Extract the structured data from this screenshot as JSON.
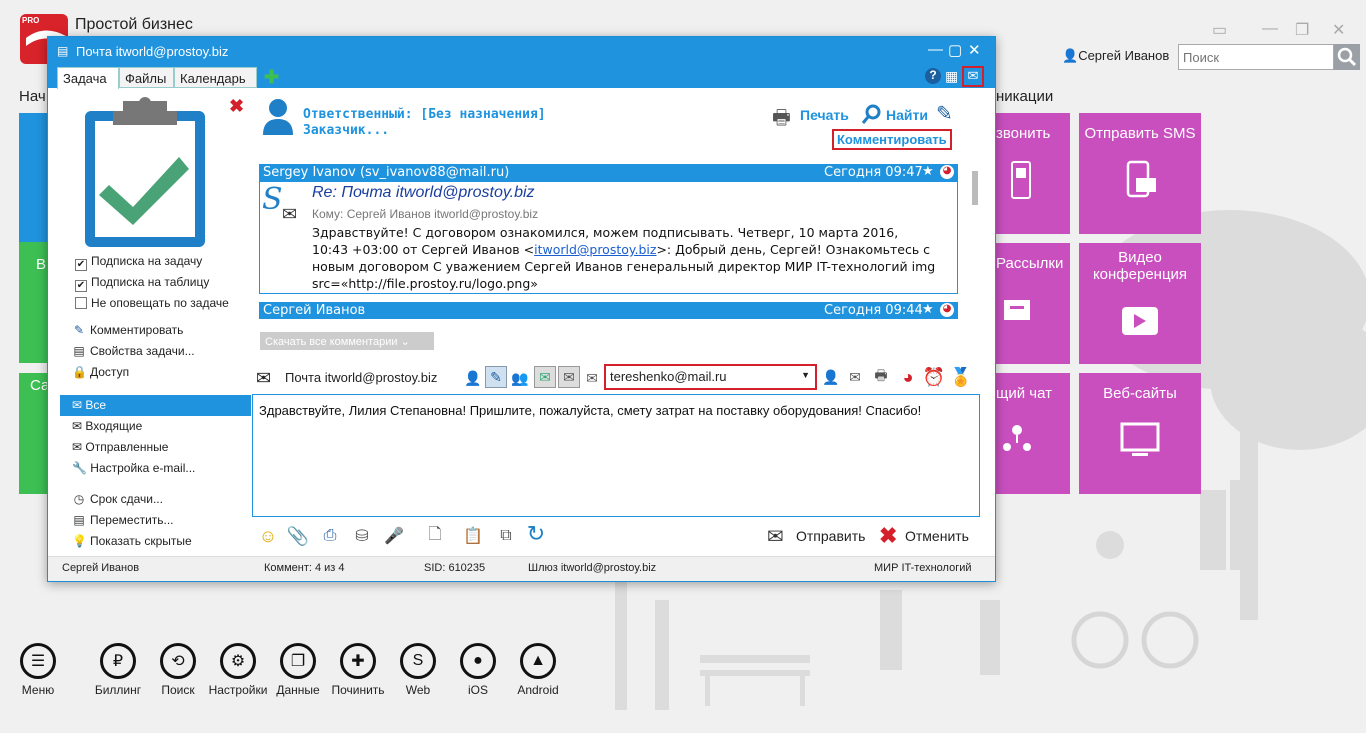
{
  "app": {
    "title": "Простой бизнес",
    "logo_text": "PRO",
    "user": "Сергей Иванов",
    "search_placeholder": "Поиск",
    "partial_left_label": "Нач",
    "partial_right_label": "никации"
  },
  "tiles": {
    "call": "звонить",
    "sms": "Отправить SMS",
    "mailing": "Рассылки",
    "video": "Видео конференция",
    "chat": "щий чат",
    "websites": "Веб-сайты",
    "left_partial_1": "В",
    "left_partial_2": "Са"
  },
  "dock": [
    {
      "label": "Меню",
      "icon": "menu-icon",
      "glyph": "☰"
    },
    {
      "label": "Биллинг",
      "icon": "billing-icon",
      "glyph": "₽"
    },
    {
      "label": "Поиск",
      "icon": "search-icon",
      "glyph": "⟲"
    },
    {
      "label": "Настройки",
      "icon": "gear-icon",
      "glyph": "⚙"
    },
    {
      "label": "Данные",
      "icon": "data-icon",
      "glyph": "❐"
    },
    {
      "label": "Починить",
      "icon": "repair-icon",
      "glyph": "✚"
    },
    {
      "label": "Web",
      "icon": "web-icon",
      "glyph": "S"
    },
    {
      "label": "iOS",
      "icon": "apple-icon",
      "glyph": "●"
    },
    {
      "label": "Android",
      "icon": "android-icon",
      "glyph": "▲"
    }
  ],
  "dialog": {
    "title": "Почта itworld@prostoy.biz",
    "tabs": [
      "Задача",
      "Файлы",
      "Календарь"
    ],
    "checkboxes": [
      {
        "label": "Подписка на задачу",
        "checked": true
      },
      {
        "label": "Подписка на таблицу",
        "checked": true
      },
      {
        "label": "Не оповещать по задаче",
        "checked": false
      }
    ],
    "actions": [
      "Комментировать",
      "Свойства задачи...",
      "Доступ"
    ],
    "folders": [
      "Все",
      "Входящие",
      "Отправленные",
      "Настройка e-mail..."
    ],
    "extras": [
      "Срок сдачи...",
      "Переместить...",
      "Показать скрытые"
    ],
    "responsible": "Ответственный: [Без назначения]",
    "customer": "Заказчик...",
    "print": "Печать",
    "find": "Найти",
    "comment_btn": "Комментировать",
    "messages": [
      {
        "from": "Sergey Ivanov (sv_ivanov88@mail.ru)",
        "time": "Сегодня 09:47",
        "subject": "Re: Почта itworld@prostoy.biz",
        "to": "Кому: Сергей Иванов itworld@prostoy.biz",
        "body_1": "Здравствуйте! С договором ознакомился, можем подписывать. Четверг, 10 марта 2016,",
        "body_2a": "10:43 +03:00 от Сергей Иванов <",
        "body_link": "itworld@prostoy.biz",
        "body_2b": ">: Добрый день, Сергей! Ознакомьтесь с",
        "body_3": "новым договором С уважением Сергей Иванов генеральный директор МИР IT-технологий img",
        "body_4": "src=«http://file.prostoy.ru/logo.png»"
      },
      {
        "from": "Сергей Иванов",
        "time": "Сегодня 09:44"
      }
    ],
    "download_all": "Скачать все комментарии",
    "mail_from": "Почта itworld@prostoy.biz",
    "to_value": "tereshenko@mail.ru",
    "comment_text": "Здравствуйте, Лилия Степановна! Пришлите, пожалуйста, смету затрат на поставку оборудования! Спасибо!",
    "send": "Отправить",
    "cancel": "Отменить",
    "status": {
      "user": "Сергей Иванов",
      "comment": "Коммент: 4 из 4",
      "sid": "SID: 610235",
      "gateway": "Шлюз itworld@prostoy.biz",
      "company": "МИР IT-технологий"
    }
  },
  "colors": {
    "accent": "#1f93dd",
    "tile_magenta": "#c94fbf",
    "tile_blue": "#1f93dd",
    "tile_green": "#3dbf54",
    "highlight_red": "#d4202a"
  }
}
